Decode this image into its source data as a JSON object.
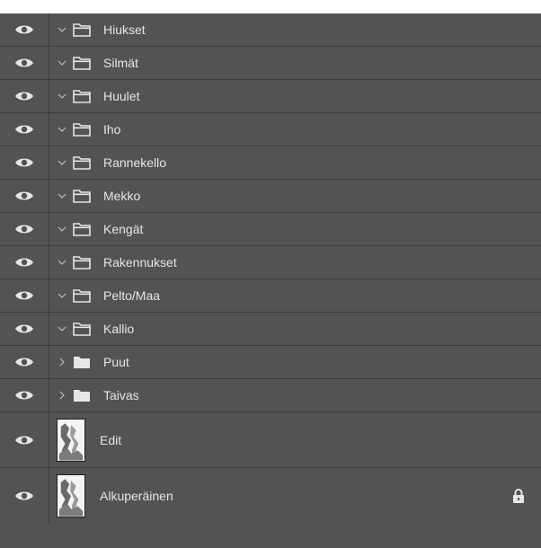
{
  "layers": [
    {
      "name": "Hiukset",
      "type": "group",
      "expanded": true,
      "visible": true
    },
    {
      "name": "Silmät",
      "type": "group",
      "expanded": true,
      "visible": true
    },
    {
      "name": "Huulet",
      "type": "group",
      "expanded": true,
      "visible": true
    },
    {
      "name": "Iho",
      "type": "group",
      "expanded": true,
      "visible": true
    },
    {
      "name": "Rannekello",
      "type": "group",
      "expanded": true,
      "visible": true
    },
    {
      "name": "Mekko",
      "type": "group",
      "expanded": true,
      "visible": true
    },
    {
      "name": "Kengät",
      "type": "group",
      "expanded": true,
      "visible": true
    },
    {
      "name": "Rakennukset",
      "type": "group",
      "expanded": true,
      "visible": true
    },
    {
      "name": "Pelto/Maa",
      "type": "group",
      "expanded": true,
      "visible": true
    },
    {
      "name": "Kallio",
      "type": "group",
      "expanded": true,
      "visible": true
    },
    {
      "name": "Puut",
      "type": "group",
      "expanded": false,
      "visible": true
    },
    {
      "name": "Taivas",
      "type": "group",
      "expanded": false,
      "visible": true
    },
    {
      "name": "Edit",
      "type": "pixel",
      "visible": true,
      "locked": false
    },
    {
      "name": "Alkuperäinen",
      "type": "pixel",
      "visible": true,
      "locked": true
    }
  ],
  "icons": {
    "visibility": "eye-icon",
    "expanded": "chevron-down-icon",
    "collapsed": "chevron-right-icon",
    "group_open": "folder-open-icon",
    "group_closed": "folder-closed-icon",
    "lock": "lock-icon"
  },
  "colors": {
    "panel_background": "#535353",
    "row_divider": "#3d3d3d",
    "text": "#e6e6e6"
  }
}
